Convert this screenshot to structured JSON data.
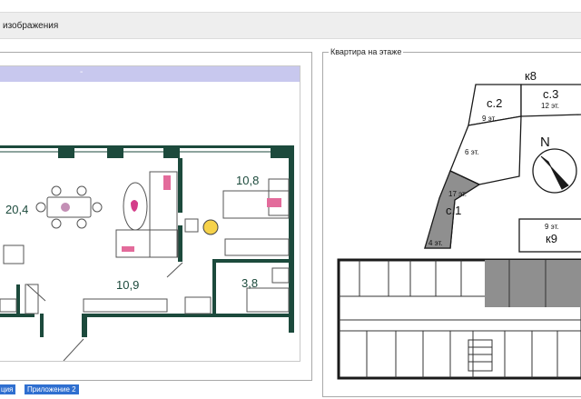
{
  "header": {
    "title": "изображения"
  },
  "left_panel": {
    "plan_header": "-"
  },
  "floor_plan": {
    "rooms": {
      "living": "20,4",
      "bedroom": "10,8",
      "hall": "10,9",
      "bath": "3,8"
    }
  },
  "right_panel": {
    "legend": "Квартира на этаже",
    "sections": {
      "k8": "к8",
      "c2": "с.2",
      "c2_floors": "9 эт.",
      "c3": "с.3",
      "c3_floors": "12 эт.",
      "c1": "с.1",
      "c1_floors": "17 эт.",
      "floors6": "6 эт.",
      "floors4": "4 эт.",
      "k9": "к9",
      "k9_floors": "9 эт."
    },
    "compass": "N"
  },
  "buttons": {
    "left": "ция",
    "right": "Приложение 2"
  },
  "colors": {
    "wall": "#1c4a3c",
    "highlight": "#8f8f8f",
    "accent": "#2f6fd0"
  }
}
